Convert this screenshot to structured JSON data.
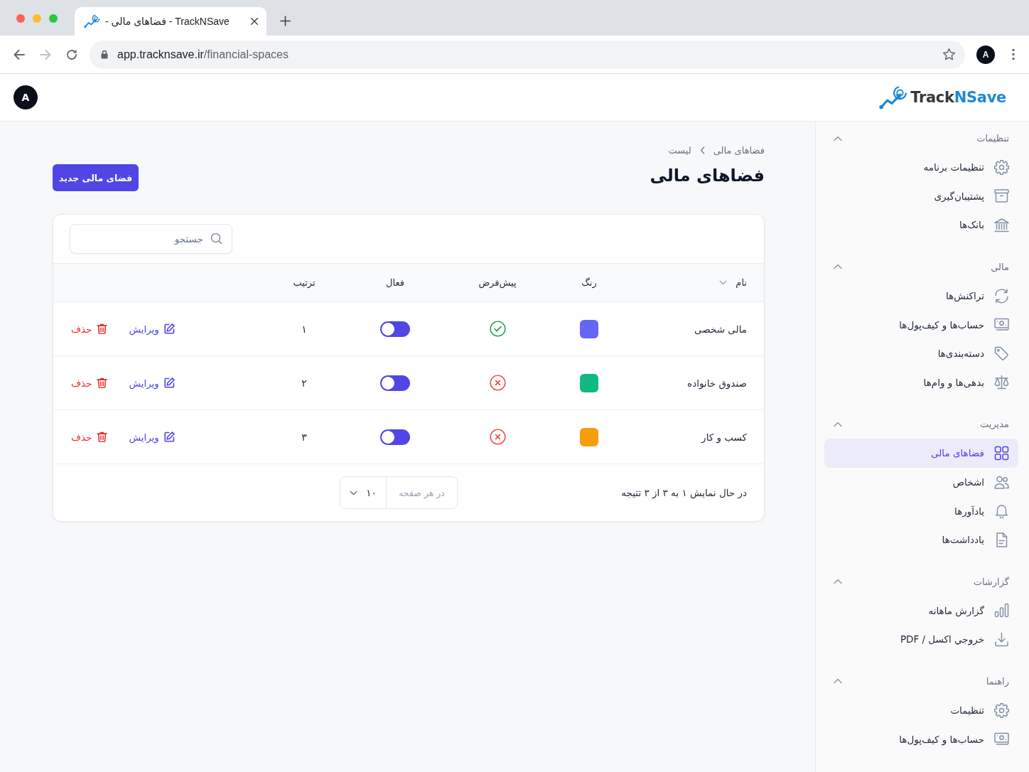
{
  "browser": {
    "tab": {
      "title": "- فضاهای مالی - TrackNSave"
    },
    "url": {
      "host": "app.tracknsave.ir",
      "path": "/financial-spaces"
    },
    "forward_disabled": true,
    "profile": "A"
  },
  "header": {
    "avatar": "A",
    "logo": {
      "dark": "Track",
      "accent": "NSave"
    }
  },
  "breadcrumb": [
    "فضاهای مالی",
    "لیست"
  ],
  "title": "فضاهای مالی",
  "new_button": "فضای مالی جدید",
  "search": {
    "placeholder": "جستجو"
  },
  "table": {
    "columns": [
      {
        "label": "نام",
        "sortable": true
      },
      {
        "label": "رنگ",
        "sortable": false
      },
      {
        "label": "پیش‌فرض",
        "sortable": false
      },
      {
        "label": "فعال",
        "sortable": false
      },
      {
        "label": "ترتیب",
        "sortable": false
      }
    ],
    "rows": [
      {
        "name": "مالی شخصی",
        "color": "#6366f1",
        "default": true,
        "active": true,
        "order": "۱",
        "edit": "ویرایش",
        "delete": "حذف"
      },
      {
        "name": "صندوق خانواده",
        "color": "#10b981",
        "default": false,
        "active": true,
        "order": "۲",
        "edit": "ویرایش",
        "delete": "حذف"
      },
      {
        "name": "کسب و کار",
        "color": "#f59e0b",
        "default": false,
        "active": true,
        "order": "۳",
        "edit": "ویرایش",
        "delete": "حذف"
      }
    ]
  },
  "footer": {
    "summary": "در حال نمایش ۱ به ۳ از ۳ تتیجه",
    "page_size_label": "در هر صفحه",
    "page_size": "۱۰"
  },
  "sidebar": {
    "groups": [
      {
        "title": "تنظیمات",
        "expanded": true,
        "items": [
          {
            "label": "تنظیمات برنامه",
            "selected": false
          },
          {
            "label": "پشتیبان‌گیری",
            "selected": false
          },
          {
            "label": "بانک‌ها",
            "selected": false
          }
        ]
      },
      {
        "title": "مالی",
        "expanded": true,
        "items": [
          {
            "label": "تراکنش‌ها",
            "selected": false
          },
          {
            "label": "حساب‌ها و کیف‌پول‌ها",
            "selected": false
          },
          {
            "label": "دسته‌بندی‌ها",
            "selected": false
          },
          {
            "label": "بدهی‌ها و وام‌ها",
            "selected": false
          }
        ]
      },
      {
        "title": "مدیریت",
        "expanded": true,
        "items": [
          {
            "label": "فضاهای مالی",
            "selected": true
          },
          {
            "label": "اشخاص",
            "selected": false
          },
          {
            "label": "یادآورها",
            "selected": false
          },
          {
            "label": "یادداشت‌ها",
            "selected": false
          }
        ]
      },
      {
        "title": "گزارشات",
        "expanded": true,
        "items": [
          {
            "label": "گزارش ماهانه",
            "selected": false
          },
          {
            "label": "خروجي اکسل / PDF",
            "selected": false
          }
        ]
      },
      {
        "title": "راهنما",
        "expanded": true,
        "items": [
          {
            "label": "تنظیمات",
            "selected": false
          },
          {
            "label": "حساب‌ها و کیف‌پول‌ها",
            "selected": false
          }
        ]
      }
    ]
  }
}
